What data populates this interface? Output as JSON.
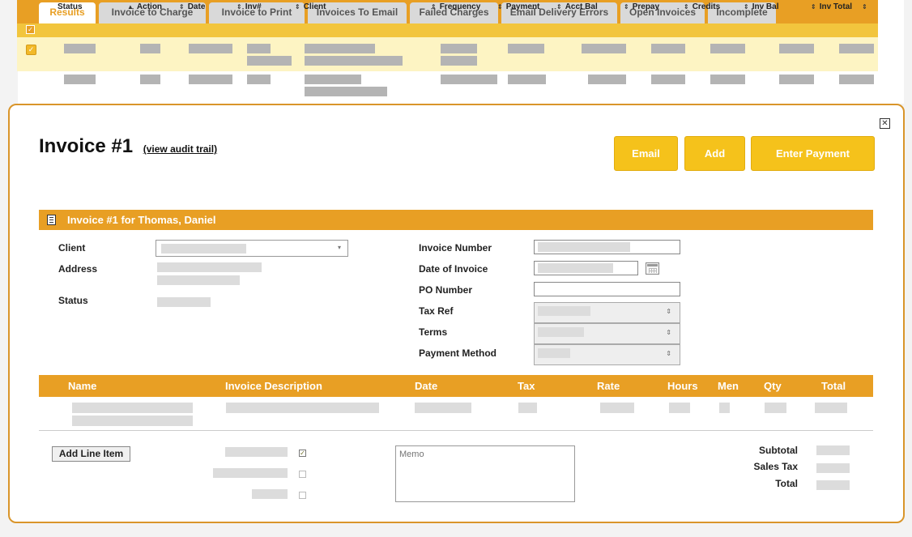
{
  "tabs": [
    {
      "label": "Results",
      "active": true
    },
    {
      "label": "Invoice to Charge"
    },
    {
      "label": "Invoice to Print"
    },
    {
      "label": "Invoices To Email"
    },
    {
      "label": "Failed Charges"
    },
    {
      "label": "Email Delivery Errors"
    },
    {
      "label": "Open Invoices"
    },
    {
      "label": "Incomplete"
    }
  ],
  "columns": [
    "Status",
    "Action",
    "Date",
    "Inv#",
    "Client",
    "Frequency",
    "Payment",
    "Acct Bal",
    "Prepay",
    "Credits",
    "Inv Bal",
    "Inv Total"
  ],
  "icons": {
    "check": "check-icon",
    "close": "close-icon",
    "calendar": "calendar-icon",
    "section": "form-icon"
  },
  "colors": {
    "accent": "#e89f24",
    "button": "#f5c21b",
    "header_yellow": "#f2c53d",
    "row_highlight": "#fdf4c3"
  },
  "invoice": {
    "title": "Invoice #1",
    "audit_link": "(view audit trail)",
    "buttons": {
      "email": "Email",
      "add": "Add",
      "enter_payment": "Enter Payment"
    },
    "section_title": "Invoice #1 for Thomas, Daniel",
    "labels": {
      "client": "Client",
      "address": "Address",
      "status": "Status",
      "invoice_number": "Invoice Number",
      "date_of_invoice": "Date of Invoice",
      "po_number": "PO Number",
      "tax_ref": "Tax Ref",
      "terms": "Terms",
      "payment_method": "Payment Method"
    },
    "line_headers": [
      "Name",
      "Invoice Description",
      "Date",
      "Tax",
      "Rate",
      "Hours",
      "Men",
      "Qty",
      "Total"
    ],
    "add_line_item": "Add Line Item",
    "memo_placeholder": "Memo",
    "totals": {
      "subtotal": "Subtotal",
      "sales_tax": "Sales Tax",
      "total": "Total"
    }
  }
}
